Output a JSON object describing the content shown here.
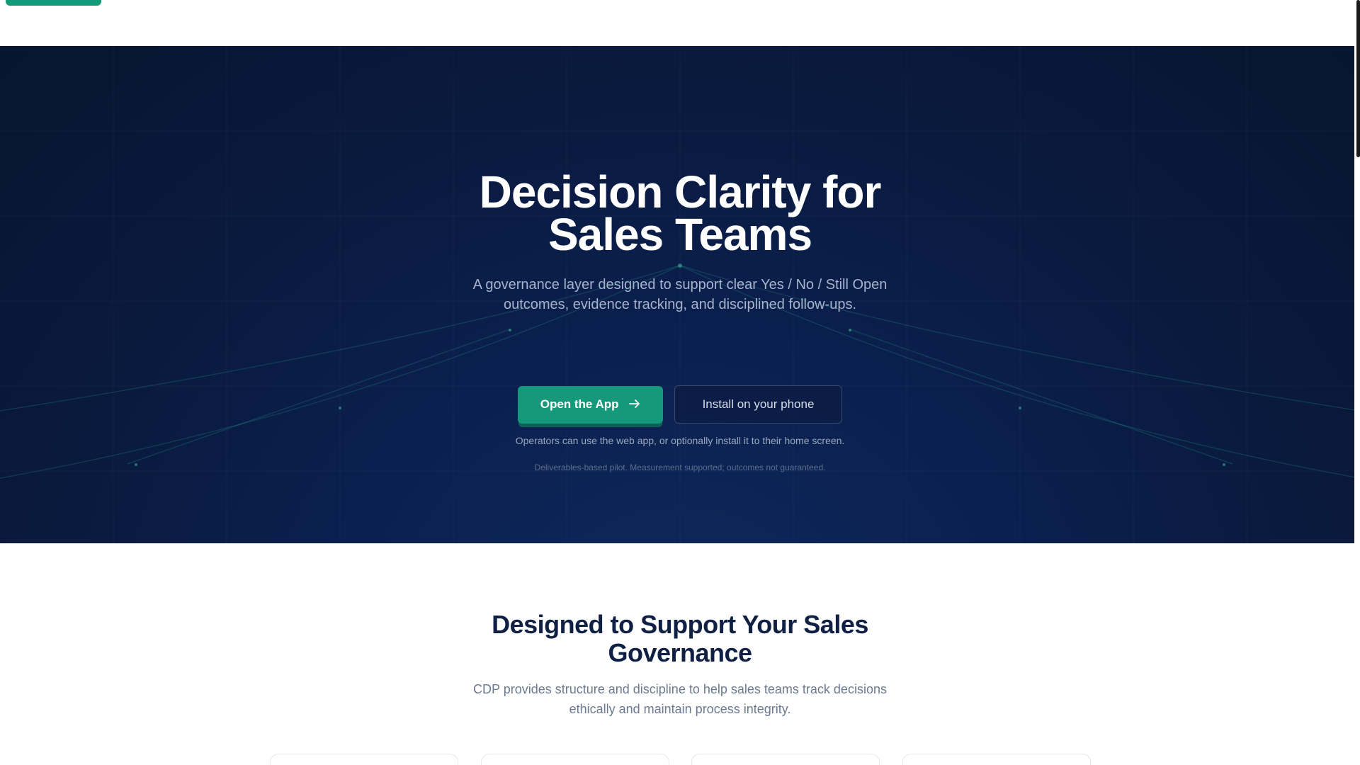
{
  "hero": {
    "title_line1": "Decision Clarity for",
    "title_line2": "Sales Teams",
    "subtitle_line1": "A governance layer designed to support clear Yes / No / Still Open",
    "subtitle_line2": "outcomes, evidence tracking, and disciplined follow-ups.",
    "primary_button": "Open the App",
    "secondary_button": "Install on your phone",
    "note": "Operators can use the web app, or optionally install it to their home screen.",
    "fine_print": "Deliverables-based pilot. Measurement supported; outcomes not guaranteed."
  },
  "features": {
    "title_line1": "Designed to Support Your Sales",
    "title_line2": "Governance",
    "subtitle_line1": "CDP provides structure and discipline to help sales teams track decisions",
    "subtitle_line2": "ethically and maintain process integrity."
  },
  "colors": {
    "accent": "#15997a",
    "hero_bg": "#0a1a3e",
    "heading_dark": "#0f2044"
  },
  "icons": {
    "primary_button_icon": "arrow-right-icon"
  }
}
